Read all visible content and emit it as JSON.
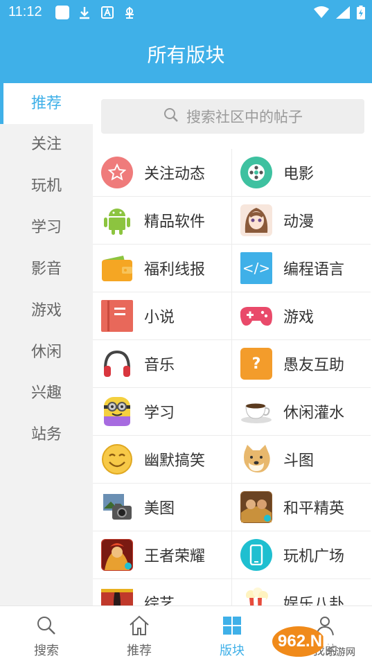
{
  "status": {
    "time": "11:12"
  },
  "header": {
    "title": "所有版块"
  },
  "nav": {
    "items": [
      {
        "label": "推荐",
        "active": true
      },
      {
        "label": "关注"
      },
      {
        "label": "玩机"
      },
      {
        "label": "学习"
      },
      {
        "label": "影音"
      },
      {
        "label": "游戏"
      },
      {
        "label": "休闲"
      },
      {
        "label": "兴趣"
      },
      {
        "label": "站务"
      }
    ]
  },
  "search": {
    "placeholder": "搜索社区中的帖子"
  },
  "boards": [
    {
      "label": "关注动态",
      "icon": "star-icon",
      "color": "#ef7b7b"
    },
    {
      "label": "电影",
      "icon": "film-reel-icon",
      "color": "#3ec1a0"
    },
    {
      "label": "精品软件",
      "icon": "android-icon",
      "color": "#8cc43f"
    },
    {
      "label": "动漫",
      "icon": "anime-girl-icon",
      "color": "#f3d6c8"
    },
    {
      "label": "福利线报",
      "icon": "wallet-icon",
      "color": "#f5a623"
    },
    {
      "label": "编程语言",
      "icon": "code-icon",
      "color": "#3fb0e8"
    },
    {
      "label": "小说",
      "icon": "book-icon",
      "color": "#e8685a"
    },
    {
      "label": "游戏",
      "icon": "gamepad-icon",
      "color": "#e94a6a"
    },
    {
      "label": "音乐",
      "icon": "headphones-icon",
      "color": "#d9363e"
    },
    {
      "label": "愚友互助",
      "icon": "question-icon",
      "color": "#f39c2b"
    },
    {
      "label": "学习",
      "icon": "minion-icon",
      "color": "#f4d03f"
    },
    {
      "label": "休闲灌水",
      "icon": "coffee-cup-icon",
      "color": "#8a7a6a"
    },
    {
      "label": "幽默搞笑",
      "icon": "smiley-icon",
      "color": "#f7c948"
    },
    {
      "label": "斗图",
      "icon": "doge-icon",
      "color": "#e8b86d"
    },
    {
      "label": "美图",
      "icon": "photo-icon",
      "color": "#6a8fb3"
    },
    {
      "label": "和平精英",
      "icon": "pubg-icon",
      "color": "#b87333"
    },
    {
      "label": "王者荣耀",
      "icon": "honor-of-kings-icon",
      "color": "#c0392b"
    },
    {
      "label": "玩机广场",
      "icon": "phone-icon",
      "color": "#1fbfd0"
    },
    {
      "label": "综艺",
      "icon": "stage-curtain-icon",
      "color": "#c0392b"
    },
    {
      "label": "娱乐八卦",
      "icon": "popcorn-icon",
      "color": "#e74c3c"
    }
  ],
  "tabbar": {
    "items": [
      {
        "label": "搜索",
        "icon": "search-icon"
      },
      {
        "label": "推荐",
        "icon": "home-icon"
      },
      {
        "label": "版块",
        "icon": "grid-icon",
        "active": true
      },
      {
        "label": "我的",
        "icon": "user-icon"
      }
    ]
  },
  "watermark": {
    "text": "962.NET",
    "sub": "乐游网"
  }
}
